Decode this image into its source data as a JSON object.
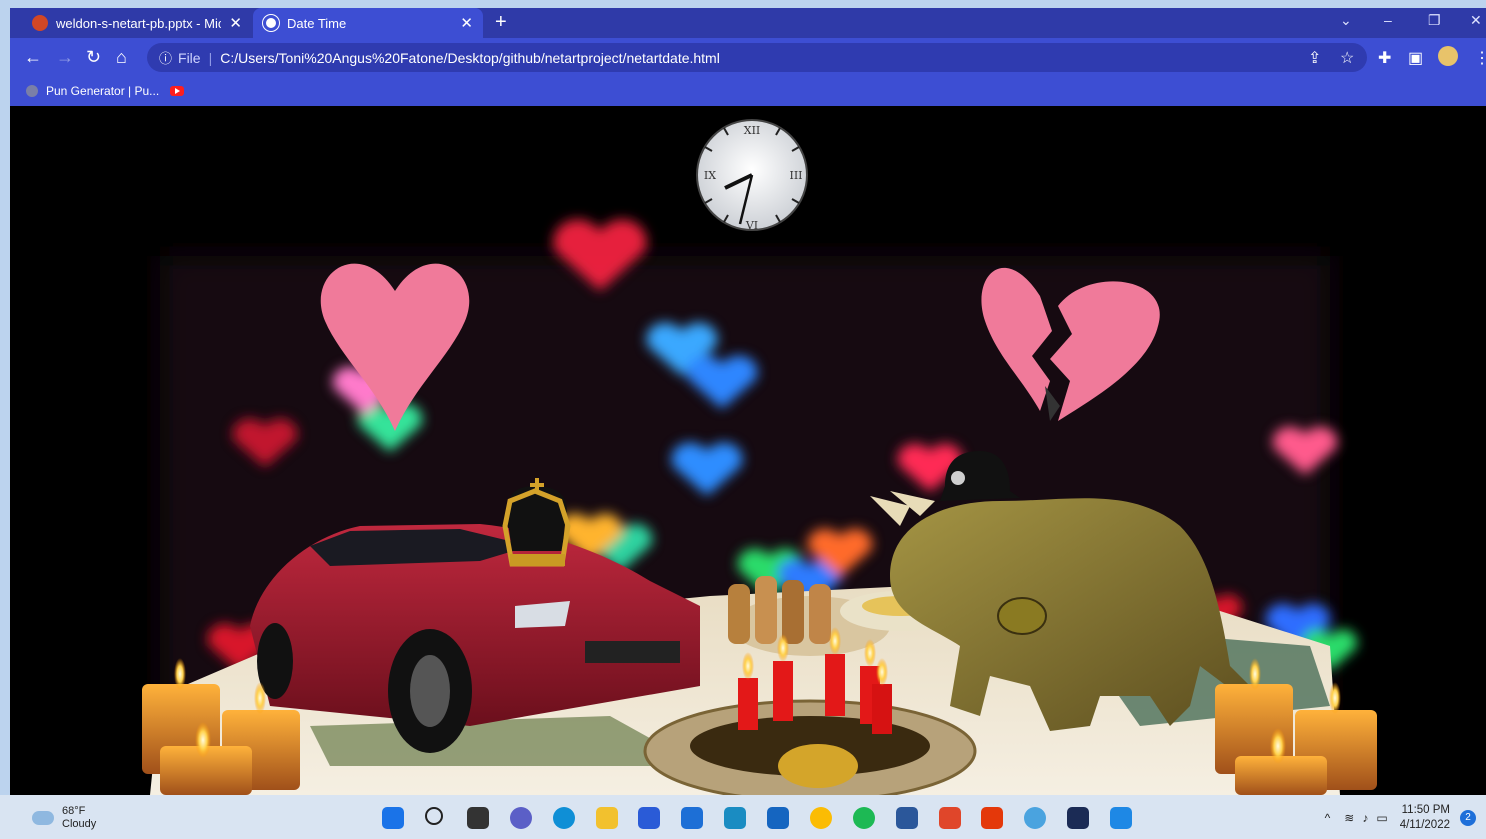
{
  "browser": {
    "tabs": [
      {
        "title": "weldon-s-netart-pb.pptx - Microsoft PowerPoint",
        "active": false
      },
      {
        "title": "Date Time",
        "active": true
      }
    ],
    "new_tab": "+",
    "address": {
      "info_icon": "ⓘ",
      "scheme_label": "File",
      "separator": "|",
      "url": "C:/Users/Toni%20Angus%20Fatone/Desktop/github/netartproject/netartdate.html"
    },
    "bookmarks": [
      {
        "label": "Pun Generator | Pu..."
      }
    ],
    "window_controls": {
      "minimize": "–",
      "restore": "❐",
      "close": "✕",
      "tabsearch": "⌄"
    }
  },
  "page": {
    "clock": {
      "numerals": [
        "XII",
        "III",
        "VI",
        "IX"
      ]
    },
    "colors": {
      "accent": "#3d4ed3",
      "tabbar": "#2f3aa8"
    }
  },
  "taskbar": {
    "weather": {
      "temp": "68°F",
      "condition": "Cloudy"
    },
    "time": "11:50 PM",
    "date": "4/11/2022",
    "notification_count": "2"
  }
}
